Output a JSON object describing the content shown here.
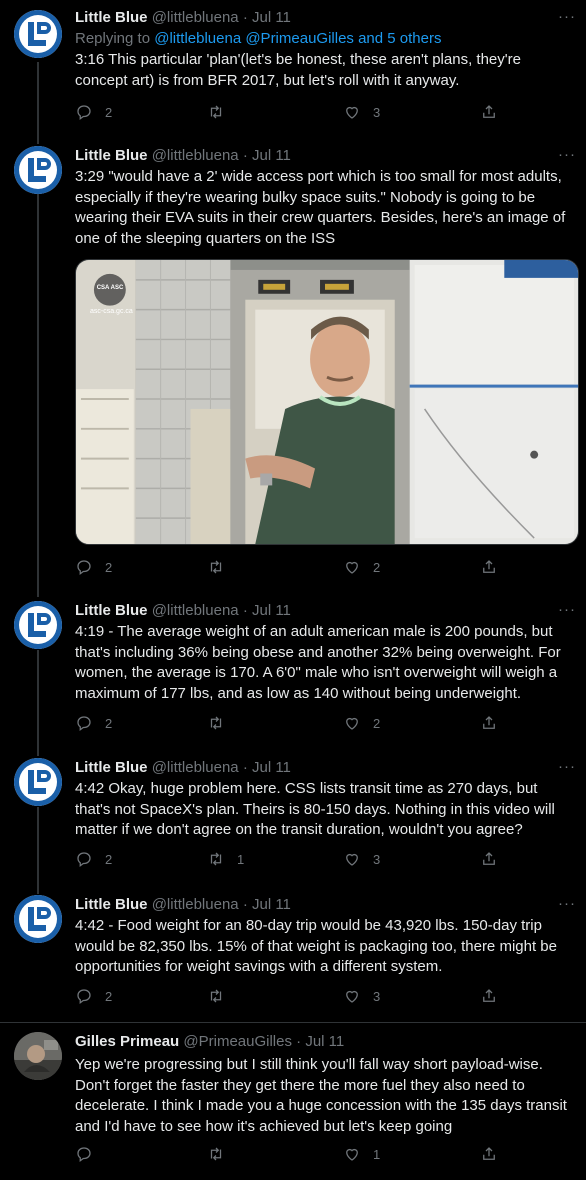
{
  "tweets": [
    {
      "name": "Little Blue",
      "handle": "@littlebluena",
      "sep": "·",
      "date": "Jul 11",
      "replying_prefix": "Replying to ",
      "replying_users": "@littlebluena @PrimeauGilles and 5 others",
      "text": "3:16 This particular 'plan'(let's be honest, these aren't plans, they're concept art) is from BFR 2017, but let's roll with it anyway.",
      "replies": "2",
      "retweets": "",
      "likes": "3"
    },
    {
      "name": "Little Blue",
      "handle": "@littlebluena",
      "sep": "·",
      "date": "Jul 11",
      "text": "3:29 \"would have a 2' wide access port which is too small for most adults, especially if they're wearing bulky space suits.\" Nobody is going to be wearing their EVA suits in their crew quarters. Besides, here's an image of one of the sleeping quarters on the ISS",
      "media_watermark": "asc-csa.gc.ca",
      "media_logo": "CSA ASC",
      "replies": "2",
      "retweets": "",
      "likes": "2"
    },
    {
      "name": "Little Blue",
      "handle": "@littlebluena",
      "sep": "·",
      "date": "Jul 11",
      "text": "4:19 - The average weight of an adult american male is 200 pounds, but that's including 36% being obese and another 32% being overweight. For women, the average is 170. A 6'0\" male who isn't overweight will weigh a maximum of 177 lbs, and as low as 140 without being underweight.",
      "replies": "2",
      "retweets": "",
      "likes": "2"
    },
    {
      "name": "Little Blue",
      "handle": "@littlebluena",
      "sep": "·",
      "date": "Jul 11",
      "text": "4:42 Okay, huge problem here. CSS lists transit time as 270 days, but that's not SpaceX's plan. Theirs is 80-150 days. Nothing in this video will matter if we don't agree on the transit duration, wouldn't you agree?",
      "replies": "2",
      "retweets": "1",
      "likes": "3"
    },
    {
      "name": "Little Blue",
      "handle": "@littlebluena",
      "sep": "·",
      "date": "Jul 11",
      "text": "4:42 - Food weight for an 80-day trip would be 43,920 lbs. 150-day trip would be 82,350 lbs. 15% of that weight is packaging too, there might be opportunities for weight savings with a different system.",
      "replies": "2",
      "retweets": "",
      "likes": "3"
    },
    {
      "name": "Gilles Primeau",
      "handle": "@PrimeauGilles",
      "sep": "·",
      "date": "Jul 11",
      "text": "Yep we're progressing but I still think you'll fall way short payload-wise. Don't forget the faster they get there the more fuel they also need to decelerate. I think I made you a huge concession with the 135 days transit and I'd have to see how it's achieved but let's keep going",
      "replies": "",
      "retweets": "",
      "likes": "1"
    }
  ],
  "more_glyph": "···",
  "colors": {
    "background": "#000000",
    "text": "#e7e9ea",
    "muted": "#71767b",
    "link": "#1d9bf0",
    "avatar_blue": "#1a5fa8"
  },
  "icons": [
    "reply-icon",
    "retweet-icon",
    "like-icon",
    "share-icon",
    "more-icon"
  ]
}
